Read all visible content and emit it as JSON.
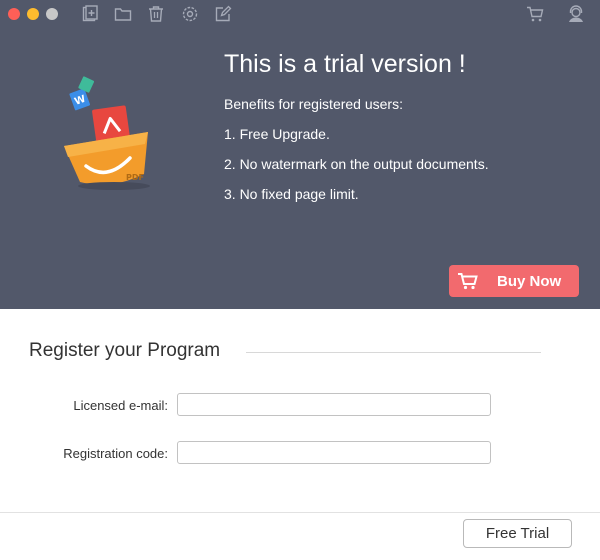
{
  "window": {
    "toolbar_icons": [
      "add-file-icon",
      "folder-icon",
      "trash-icon",
      "settings-icon",
      "edit-icon",
      "cart-icon",
      "support-icon"
    ]
  },
  "trial": {
    "title": "This is a trial version !",
    "benefits_heading": "Benefits for registered users:",
    "benefits": [
      "1. Free Upgrade.",
      "2. No watermark on the output documents.",
      "3. No fixed page limit."
    ],
    "buy_label": "Buy Now",
    "illustration_label": "PDF"
  },
  "register": {
    "title": "Register your Program",
    "email_label": "Licensed e-mail:",
    "email_value": "",
    "code_label": "Registration code:",
    "code_value": ""
  },
  "footer": {
    "free_trial_label": "Free Trial"
  },
  "colors": {
    "header_bg": "#52586a",
    "buy_button": "#f26a6e",
    "basket": "#f39c2b"
  }
}
